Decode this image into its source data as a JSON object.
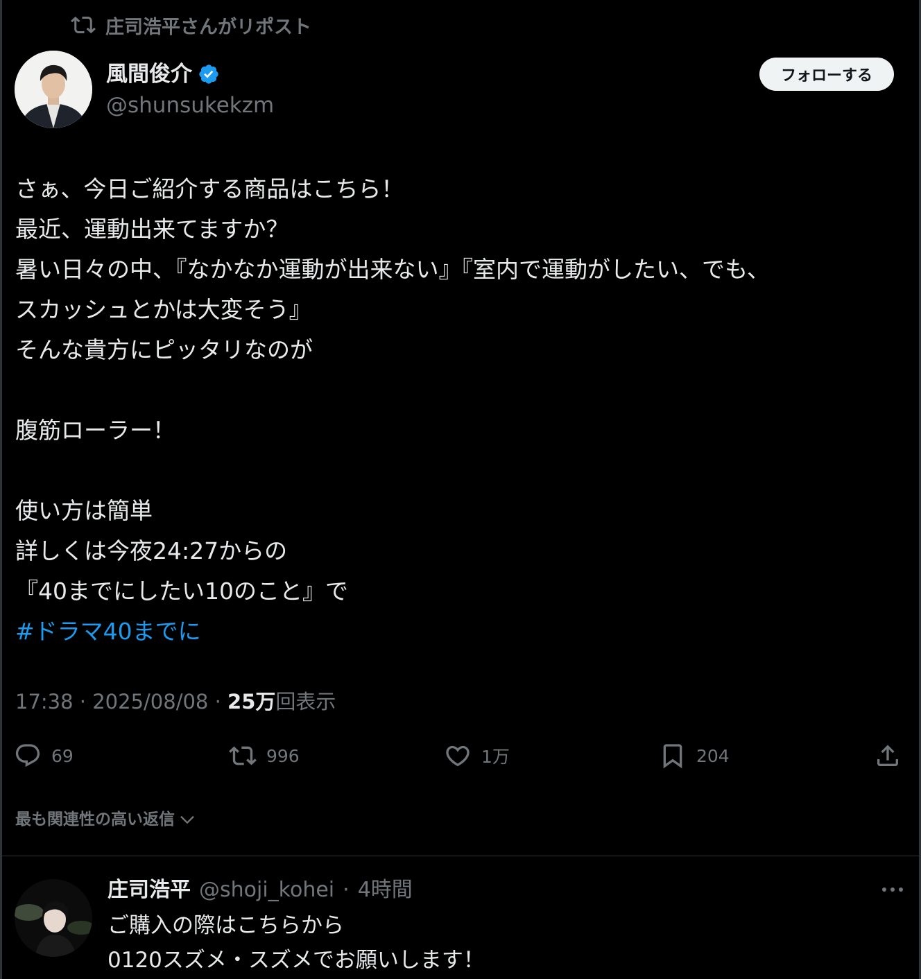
{
  "repost": {
    "label": "庄司浩平さんがリポスト",
    "icon": "repost-icon"
  },
  "author": {
    "name": "風間俊介",
    "handle": "@shunsukekzm",
    "verified": true,
    "verified_color": "#1d9bf0"
  },
  "follow_button": {
    "label": "フォローする"
  },
  "tweet": {
    "lines": [
      "さぁ、今日ご紹介する商品はこちら！",
      "最近、運動出来てますか？",
      "暑い日々の中、『なかなか運動が出来ない』『室内で運動がしたい、でも、",
      "スカッシュとかは大変そう』",
      "そんな貴方にピッタリなのが",
      "",
      "腹筋ローラー！",
      "",
      "使い方は簡単",
      "詳しくは今夜24:27からの",
      "『40までにしたい10のこと』で"
    ],
    "hashtag": "#ドラマ40までに",
    "hashtag_color": "#1d9bf0"
  },
  "meta": {
    "time": "17:38",
    "separator": " · ",
    "date": "2025/08/08",
    "views_count": "25万",
    "views_label": "回表示"
  },
  "actions": {
    "replies": "69",
    "reposts": "996",
    "likes": "1万",
    "bookmarks": "204"
  },
  "replies_sort": {
    "label": "最も関連性の高い返信"
  },
  "reply": {
    "name": "庄司浩平",
    "handle": "@shoji_kohei",
    "dot": "·",
    "time": "4時間",
    "lines": [
      "ご購入の際はこちらから",
      "0120スズメ・スズメでお願いします！"
    ]
  }
}
